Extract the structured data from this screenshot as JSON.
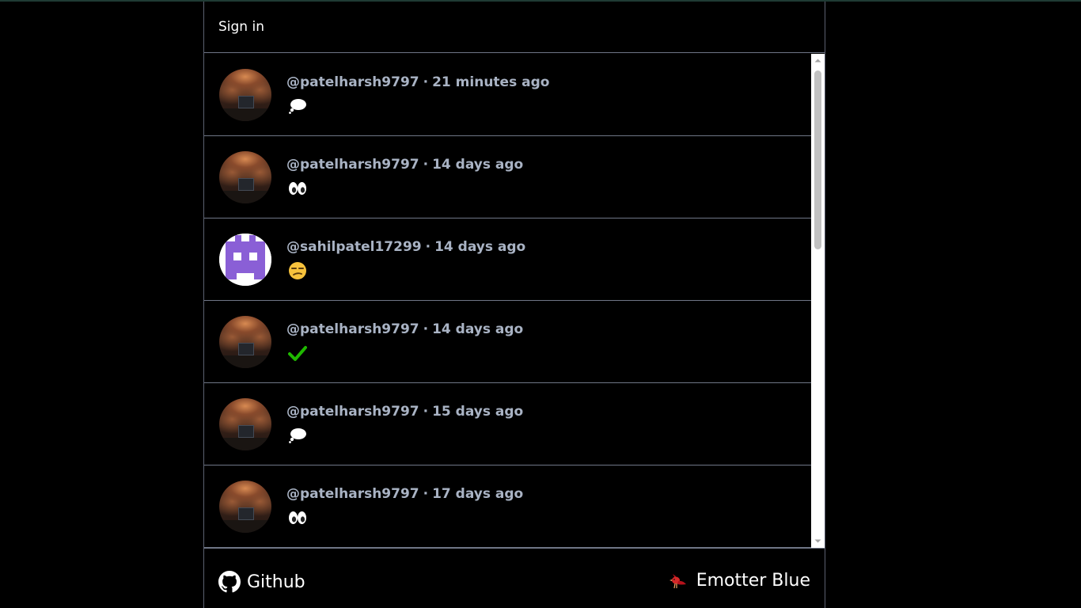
{
  "header": {
    "signin_label": "Sign in"
  },
  "posts": [
    {
      "handle": "@patelharsh9797",
      "separator": "·",
      "time": "21 minutes ago",
      "emoji_icon": "thought-bubble-icon",
      "avatar": "photo"
    },
    {
      "handle": "@patelharsh9797",
      "separator": "·",
      "time": "14 days ago",
      "emoji_icon": "eyes-icon",
      "avatar": "photo"
    },
    {
      "handle": "@sahilpatel17299",
      "separator": "·",
      "time": "14 days ago",
      "emoji_icon": "unamused-face-icon",
      "avatar": "pixel"
    },
    {
      "handle": "@patelharsh9797",
      "separator": "·",
      "time": "14 days ago",
      "emoji_icon": "check-mark-icon",
      "avatar": "photo"
    },
    {
      "handle": "@patelharsh9797",
      "separator": "·",
      "time": "15 days ago",
      "emoji_icon": "thought-bubble-icon",
      "avatar": "photo"
    },
    {
      "handle": "@patelharsh9797",
      "separator": "·",
      "time": "17 days ago",
      "emoji_icon": "eyes-icon",
      "avatar": "photo"
    }
  ],
  "footer": {
    "github_label": "Github",
    "github_icon": "github-icon",
    "brand_label": "Emotter Blue",
    "brand_icon": "bird-icon"
  },
  "colors": {
    "background": "#000000",
    "border": "#6f7686",
    "meta_text": "#a9b3c4",
    "check_green": "#1fb800",
    "pixel_avatar_purple": "#8a5fd6"
  }
}
